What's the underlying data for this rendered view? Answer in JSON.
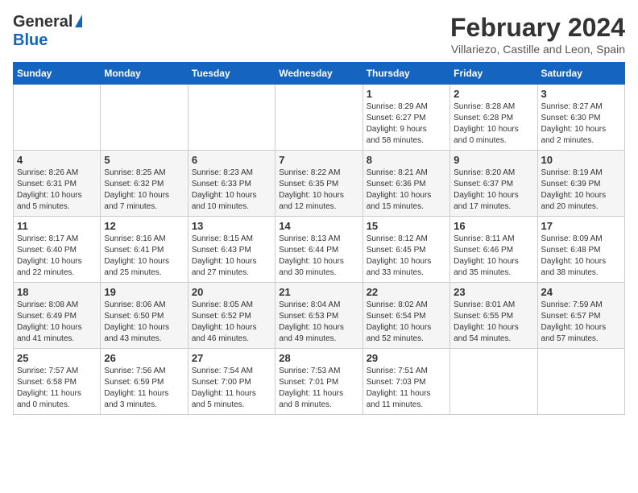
{
  "header": {
    "logo_general": "General",
    "logo_blue": "Blue",
    "month_title": "February 2024",
    "location": "Villariezo, Castille and Leon, Spain"
  },
  "days_of_week": [
    "Sunday",
    "Monday",
    "Tuesday",
    "Wednesday",
    "Thursday",
    "Friday",
    "Saturday"
  ],
  "weeks": [
    [
      {
        "day": "",
        "info": ""
      },
      {
        "day": "",
        "info": ""
      },
      {
        "day": "",
        "info": ""
      },
      {
        "day": "",
        "info": ""
      },
      {
        "day": "1",
        "info": "Sunrise: 8:29 AM\nSunset: 6:27 PM\nDaylight: 9 hours\nand 58 minutes."
      },
      {
        "day": "2",
        "info": "Sunrise: 8:28 AM\nSunset: 6:28 PM\nDaylight: 10 hours\nand 0 minutes."
      },
      {
        "day": "3",
        "info": "Sunrise: 8:27 AM\nSunset: 6:30 PM\nDaylight: 10 hours\nand 2 minutes."
      }
    ],
    [
      {
        "day": "4",
        "info": "Sunrise: 8:26 AM\nSunset: 6:31 PM\nDaylight: 10 hours\nand 5 minutes."
      },
      {
        "day": "5",
        "info": "Sunrise: 8:25 AM\nSunset: 6:32 PM\nDaylight: 10 hours\nand 7 minutes."
      },
      {
        "day": "6",
        "info": "Sunrise: 8:23 AM\nSunset: 6:33 PM\nDaylight: 10 hours\nand 10 minutes."
      },
      {
        "day": "7",
        "info": "Sunrise: 8:22 AM\nSunset: 6:35 PM\nDaylight: 10 hours\nand 12 minutes."
      },
      {
        "day": "8",
        "info": "Sunrise: 8:21 AM\nSunset: 6:36 PM\nDaylight: 10 hours\nand 15 minutes."
      },
      {
        "day": "9",
        "info": "Sunrise: 8:20 AM\nSunset: 6:37 PM\nDaylight: 10 hours\nand 17 minutes."
      },
      {
        "day": "10",
        "info": "Sunrise: 8:19 AM\nSunset: 6:39 PM\nDaylight: 10 hours\nand 20 minutes."
      }
    ],
    [
      {
        "day": "11",
        "info": "Sunrise: 8:17 AM\nSunset: 6:40 PM\nDaylight: 10 hours\nand 22 minutes."
      },
      {
        "day": "12",
        "info": "Sunrise: 8:16 AM\nSunset: 6:41 PM\nDaylight: 10 hours\nand 25 minutes."
      },
      {
        "day": "13",
        "info": "Sunrise: 8:15 AM\nSunset: 6:43 PM\nDaylight: 10 hours\nand 27 minutes."
      },
      {
        "day": "14",
        "info": "Sunrise: 8:13 AM\nSunset: 6:44 PM\nDaylight: 10 hours\nand 30 minutes."
      },
      {
        "day": "15",
        "info": "Sunrise: 8:12 AM\nSunset: 6:45 PM\nDaylight: 10 hours\nand 33 minutes."
      },
      {
        "day": "16",
        "info": "Sunrise: 8:11 AM\nSunset: 6:46 PM\nDaylight: 10 hours\nand 35 minutes."
      },
      {
        "day": "17",
        "info": "Sunrise: 8:09 AM\nSunset: 6:48 PM\nDaylight: 10 hours\nand 38 minutes."
      }
    ],
    [
      {
        "day": "18",
        "info": "Sunrise: 8:08 AM\nSunset: 6:49 PM\nDaylight: 10 hours\nand 41 minutes."
      },
      {
        "day": "19",
        "info": "Sunrise: 8:06 AM\nSunset: 6:50 PM\nDaylight: 10 hours\nand 43 minutes."
      },
      {
        "day": "20",
        "info": "Sunrise: 8:05 AM\nSunset: 6:52 PM\nDaylight: 10 hours\nand 46 minutes."
      },
      {
        "day": "21",
        "info": "Sunrise: 8:04 AM\nSunset: 6:53 PM\nDaylight: 10 hours\nand 49 minutes."
      },
      {
        "day": "22",
        "info": "Sunrise: 8:02 AM\nSunset: 6:54 PM\nDaylight: 10 hours\nand 52 minutes."
      },
      {
        "day": "23",
        "info": "Sunrise: 8:01 AM\nSunset: 6:55 PM\nDaylight: 10 hours\nand 54 minutes."
      },
      {
        "day": "24",
        "info": "Sunrise: 7:59 AM\nSunset: 6:57 PM\nDaylight: 10 hours\nand 57 minutes."
      }
    ],
    [
      {
        "day": "25",
        "info": "Sunrise: 7:57 AM\nSunset: 6:58 PM\nDaylight: 11 hours\nand 0 minutes."
      },
      {
        "day": "26",
        "info": "Sunrise: 7:56 AM\nSunset: 6:59 PM\nDaylight: 11 hours\nand 3 minutes."
      },
      {
        "day": "27",
        "info": "Sunrise: 7:54 AM\nSunset: 7:00 PM\nDaylight: 11 hours\nand 5 minutes."
      },
      {
        "day": "28",
        "info": "Sunrise: 7:53 AM\nSunset: 7:01 PM\nDaylight: 11 hours\nand 8 minutes."
      },
      {
        "day": "29",
        "info": "Sunrise: 7:51 AM\nSunset: 7:03 PM\nDaylight: 11 hours\nand 11 minutes."
      },
      {
        "day": "",
        "info": ""
      },
      {
        "day": "",
        "info": ""
      }
    ]
  ]
}
